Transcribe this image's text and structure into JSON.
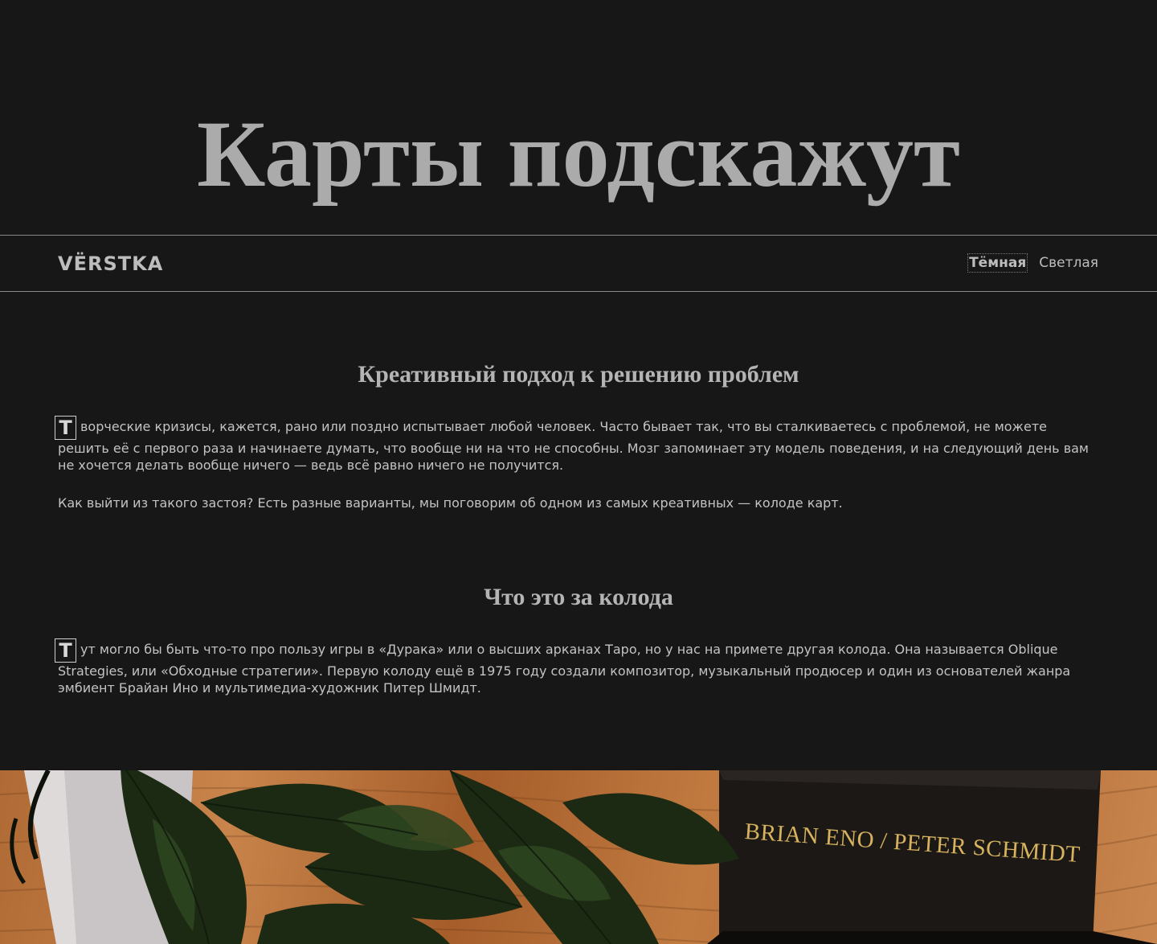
{
  "hero": {
    "title": "Карты подскажут"
  },
  "nav": {
    "logo": "VЁRSTKA",
    "themes": {
      "dark_label": "Тёмная",
      "light_label": "Светлая",
      "active": "Тёмная"
    }
  },
  "sections": [
    {
      "title": "Креативный подход к решению проблем",
      "dropcap": "Т",
      "para1_rest": "ворческие кризисы, кажется, рано или поздно испытывает любой человек. Часто бывает так, что вы сталкиваетесь с проблемой, не можете решить её с первого раза и начинаете думать, что вообще ни на что не способны. Мозг запоминает эту модель поведения, и на следующий день вам не хочется делать вообще ничего — ведь всё равно ничего не получится.",
      "para2": "Как выйти из такого застоя? Есть разные варианты, мы поговорим об одном из самых креативных — колоде карт."
    },
    {
      "title": "Что это за колода",
      "dropcap": "Т",
      "para1_rest": "ут могло бы быть что-то про пользу игры в «Дурака» или о высших арканах Таро, но у нас на примете другая колода. Она называется Oblique Strategies, или «Обходные стратегии». Первую колоду ещё в 1975 году создали композитор, музыкальный продюсер и один из основателей жанра эмбиент Брайан Ино и мультимедиа-художник Питер Шмидт."
    }
  ],
  "photo": {
    "book_spine_text": "BRIAN ENO / PETER SCHMIDT"
  },
  "colors": {
    "background": "#171717",
    "hero_text": "#ababab",
    "body_text": "#c3c3c3",
    "divider": "#8a8a8a",
    "gold_foil": "#d7b35e"
  }
}
